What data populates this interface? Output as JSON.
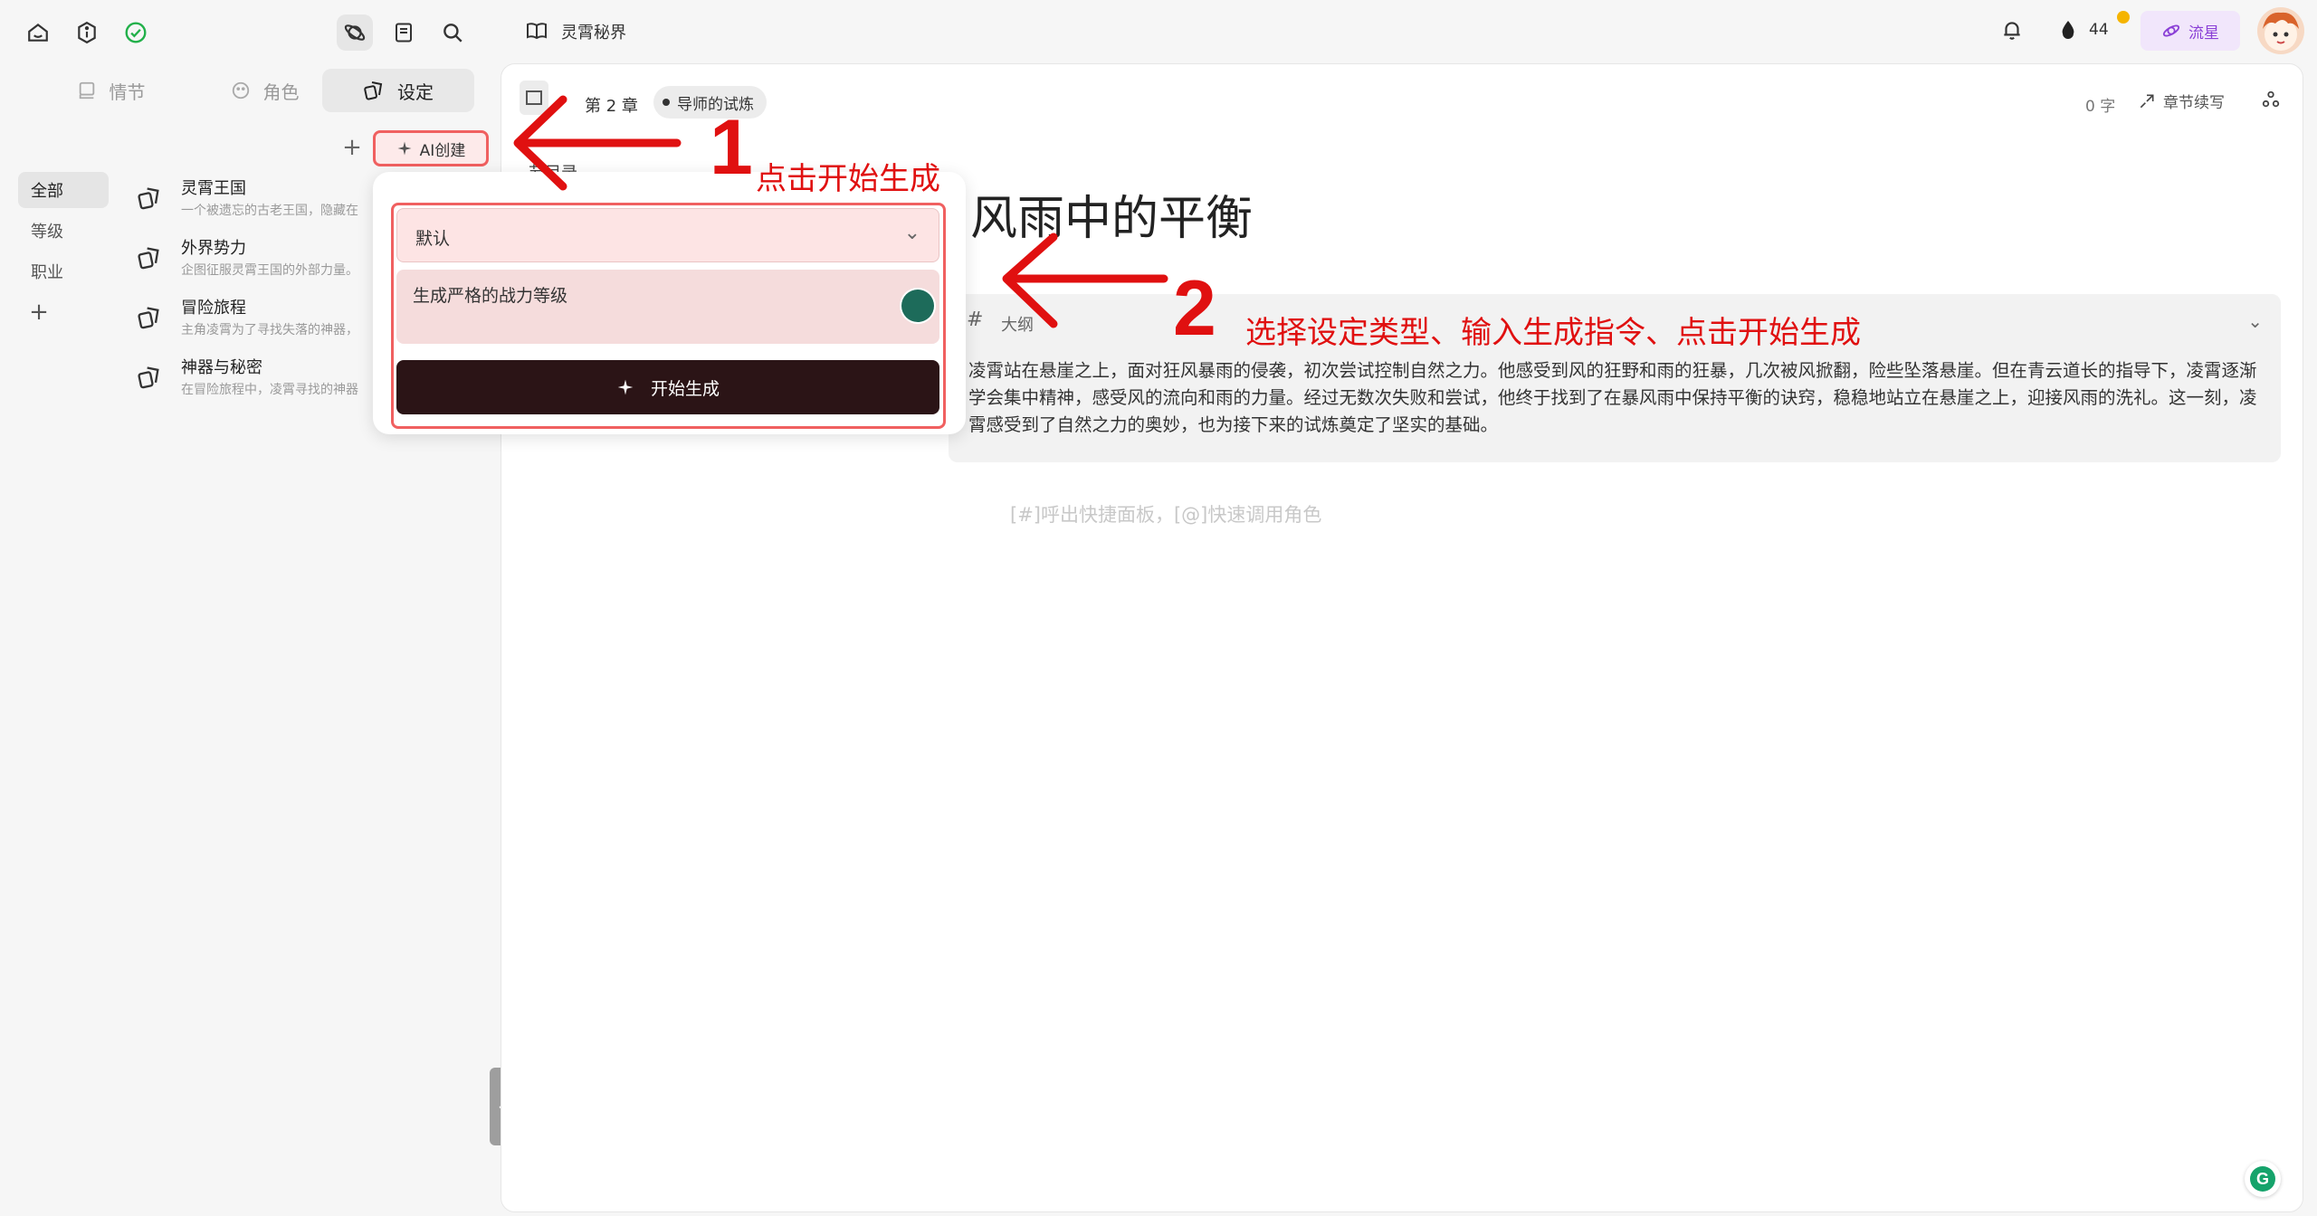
{
  "sidebar": {
    "segments": [
      {
        "label": "情节",
        "icon": "book-icon"
      },
      {
        "label": "角色",
        "icon": "smile-icon"
      },
      {
        "label": "设定",
        "icon": "cards-icon"
      }
    ],
    "add_symbol": "+",
    "ai_create_label": "AI创建",
    "categories": [
      "全部",
      "等级",
      "职业"
    ],
    "add_category_symbol": "+",
    "settings": [
      {
        "title": "灵霄王国",
        "desc": "一个被遗忘的古老王国，隐藏在"
      },
      {
        "title": "外界势力",
        "desc": "企图征服灵霄王国的外部力量。"
      },
      {
        "title": "冒险旅程",
        "desc": "主角凌霄为了寻找失落的神器，"
      },
      {
        "title": "神器与秘密",
        "desc": "在冒险旅程中，凌霄寻找的神器"
      }
    ]
  },
  "topbar": {
    "book_title": "灵霄秘界",
    "points": "44",
    "plan_label": "流星"
  },
  "editor": {
    "chapter_label": "第 2 章",
    "chapter_tag": "导师的试炼",
    "word_count": "0 字",
    "continue_label": "章节续写",
    "toc_label": "节目录",
    "title": "风雨中的平衡",
    "outline_label": "大纲",
    "outline_text": "凌霄站在悬崖之上，面对狂风暴雨的侵袭，初次尝试控制自然之力。他感受到风的狂野和雨的狂暴，几次被风掀翻，险些坠落悬崖。但在青云道长的指导下，凌霄逐渐学会集中精神，感受风的流向和雨的力量。经过无数次失败和尝试，他终于找到了在暴风雨中保持平衡的诀窍，稳稳地站立在悬崖之上，迎接风雨的洗礼。这一刻，凌霄感受到了自然之力的奥妙，也为接下来的试炼奠定了坚实的基础。",
    "hint": "[#]呼出快捷面板，[@]快速调用角色"
  },
  "popup": {
    "type_value": "默认",
    "prompt_value": "生成严格的战力等级",
    "generate_label": "开始生成"
  },
  "annotations": {
    "step1_number": "1",
    "step1_text": "点击开始生成",
    "step2_number": "2",
    "step2_text": "选择设定类型、输入生成指令、点击开始生成"
  },
  "colors": {
    "accent_red": "#e01010",
    "dark_button": "#2b1416",
    "plan_purple": "#8a3fd6",
    "badge_yellow": "#f5b400"
  }
}
